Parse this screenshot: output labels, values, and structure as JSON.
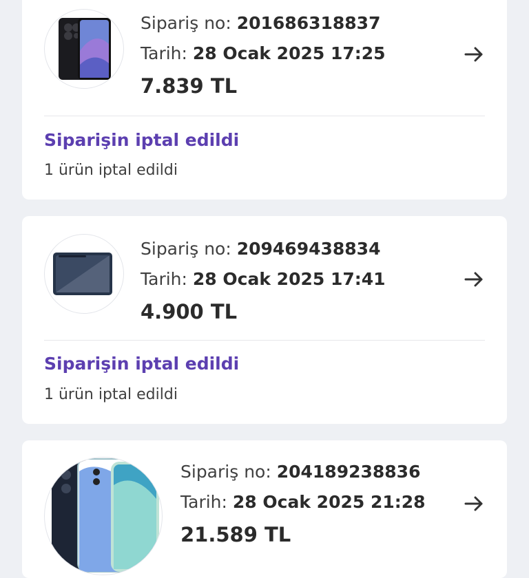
{
  "orders": [
    {
      "order_label": "Sipariş no:",
      "order_no": "201686318837",
      "date_label": "Tarih:",
      "date": "28 Ocak 2025 17:25",
      "price": "7.839 TL",
      "status": "Siparişin iptal edildi",
      "status_detail": "1 ürün iptal edildi",
      "product_icon": "smartphone-icon"
    },
    {
      "order_label": "Sipariş no:",
      "order_no": "209469438834",
      "date_label": "Tarih:",
      "date": "28 Ocak 2025 17:41",
      "price": "4.900 TL",
      "status": "Siparişin iptal edildi",
      "status_detail": "1 ürün iptal edildi",
      "product_icon": "tablet-icon"
    },
    {
      "order_label": "Sipariş no:",
      "order_no": "204189238836",
      "date_label": "Tarih:",
      "date": "28 Ocak 2025 21:28",
      "price": "21.589 TL",
      "product_icon": "smartphones-icon"
    }
  ],
  "colors": {
    "background": "#eef0f4",
    "card": "#ffffff",
    "status": "#5c3fb0",
    "text": "#2b2b2b"
  }
}
